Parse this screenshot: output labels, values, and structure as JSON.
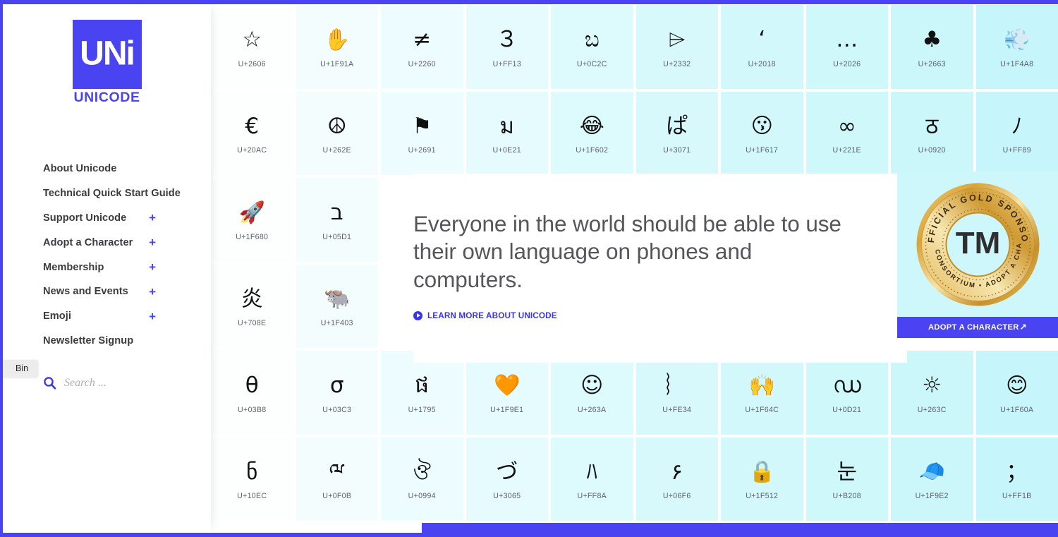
{
  "site": {
    "logo_letters": "UNi",
    "logo_word": "UNICODE"
  },
  "sidebar": {
    "nav": [
      {
        "label": "About Unicode",
        "expandable": false,
        "external": false
      },
      {
        "label": "Technical Quick Start Guide",
        "expandable": false,
        "external": false
      },
      {
        "label": "Support Unicode",
        "expandable": true,
        "plus": "+",
        "external": false
      },
      {
        "label": "Adopt a Character",
        "expandable": true,
        "plus": "+",
        "external": false
      },
      {
        "label": "Membership",
        "expandable": true,
        "plus": "+",
        "external": false
      },
      {
        "label": "News and Events",
        "expandable": true,
        "plus": "+",
        "external": false
      },
      {
        "label": "Emoji",
        "expandable": true,
        "plus": "+",
        "external": false
      },
      {
        "label": "Newsletter Signup",
        "expandable": false,
        "external": true,
        "external_glyph": "↗"
      }
    ],
    "search": {
      "icon": "search-icon",
      "value": "",
      "placeholder": "Search ..."
    }
  },
  "desktop": {
    "tooltip": "Bin"
  },
  "hero": {
    "title": "Everyone in the world should be able to use their own language on phones and computers.",
    "link_label": "LEARN MORE ABOUT UNICODE",
    "link_icon": "play-circle-icon"
  },
  "sponsor": {
    "badge_top_text": "OFFICIAL GOLD SPONSOR",
    "badge_bottom_text": "UNICODE CONSORTIUM • ADOPT A CHARACTER",
    "badge_center": "TM",
    "button_label": "ADOPT A CHARACTER",
    "button_external_glyph": "↗",
    "card_bg": "#cdf7fb",
    "button_bg": "#4a43f2",
    "gold": "#d9a33a"
  },
  "colors": {
    "brand_blue": "#4a43f2",
    "link_blue": "#3a34e8",
    "tile_cyan": "#cdf7fb",
    "text_gray": "#3b3b3f"
  },
  "grid": {
    "columns": 10,
    "tiles": [
      {
        "glyph": "☆",
        "code": "U+2606",
        "shade": 0
      },
      {
        "glyph": "✋",
        "code": "U+1F91A",
        "shade": 1,
        "emoji": true
      },
      {
        "glyph": "≠",
        "code": "U+2260",
        "shade": 2
      },
      {
        "glyph": "３",
        "code": "U+FF13",
        "shade": 3
      },
      {
        "glyph": "ಬ",
        "code": "U+0C2C",
        "shade": 4
      },
      {
        "glyph": "⌲",
        "code": "U+2332",
        "shade": 5
      },
      {
        "glyph": "‘",
        "code": "U+2018",
        "shade": 6
      },
      {
        "glyph": "…",
        "code": "U+2026",
        "shade": 7
      },
      {
        "glyph": "♣",
        "code": "U+2663",
        "shade": 8
      },
      {
        "glyph": "💨",
        "code": "U+1F4A8",
        "shade": 9,
        "emoji": true
      },
      {
        "glyph": "€",
        "code": "U+20AC",
        "shade": 0
      },
      {
        "glyph": "☮",
        "code": "U+262E",
        "shade": 1
      },
      {
        "glyph": "⚑",
        "code": "U+2691",
        "shade": 2
      },
      {
        "glyph": "ม",
        "code": "U+0E21",
        "shade": 3
      },
      {
        "glyph": "😂",
        "code": "U+1F602",
        "shade": 4,
        "emoji": true
      },
      {
        "glyph": "ぱ",
        "code": "U+3071",
        "shade": 5
      },
      {
        "glyph": "😗",
        "code": "U+1F617",
        "shade": 6,
        "emoji": true
      },
      {
        "glyph": "∞",
        "code": "U+221E",
        "shade": 7
      },
      {
        "glyph": "ठ",
        "code": "U+0920",
        "shade": 8
      },
      {
        "glyph": "ﾉ",
        "code": "U+FF89",
        "shade": 9
      },
      {
        "glyph": "🚀",
        "code": "U+1F680",
        "shade": 0,
        "emoji": true
      },
      {
        "glyph": "ב",
        "code": "U+05D1",
        "shade": 1
      },
      {
        "glyph": "炎",
        "code": "U+708E",
        "shade": 0
      },
      {
        "glyph": "🐃",
        "code": "U+1F403",
        "shade": 1,
        "emoji": true
      },
      {
        "glyph": "θ",
        "code": "U+03B8",
        "shade": 0
      },
      {
        "glyph": "σ",
        "code": "U+03C3",
        "shade": 1
      },
      {
        "glyph": "ផ",
        "code": "U+1795",
        "shade": 2
      },
      {
        "glyph": "🧡",
        "code": "U+1F9E1",
        "shade": 3,
        "emoji": true
      },
      {
        "glyph": "☺",
        "code": "U+263A",
        "shade": 4
      },
      {
        "glyph": "︴",
        "code": "U+FE34",
        "shade": 5
      },
      {
        "glyph": "🙌",
        "code": "U+1F64C",
        "shade": 6,
        "emoji": true
      },
      {
        "glyph": "ഡ",
        "code": "U+0D21",
        "shade": 7
      },
      {
        "glyph": "☼",
        "code": "U+263C",
        "shade": 8
      },
      {
        "glyph": "😊",
        "code": "U+1F60A",
        "shade": 9,
        "emoji": true
      },
      {
        "glyph": "ნ",
        "code": "U+10EC",
        "shade": 0
      },
      {
        "glyph": "ྋ",
        "code": "U+0F0B",
        "shade": 1
      },
      {
        "glyph": "ঔ",
        "code": "U+0994",
        "shade": 2
      },
      {
        "glyph": "づ",
        "code": "U+3065",
        "shade": 3
      },
      {
        "glyph": "ﾊ",
        "code": "U+FF8A",
        "shade": 4
      },
      {
        "glyph": "۶",
        "code": "U+06F6",
        "shade": 5
      },
      {
        "glyph": "🔒",
        "code": "U+1F512",
        "shade": 6,
        "emoji": true
      },
      {
        "glyph": "눈",
        "code": "U+B208",
        "shade": 7
      },
      {
        "glyph": "🧢",
        "code": "U+1F9E2",
        "shade": 8,
        "emoji": true
      },
      {
        "glyph": "；",
        "code": "U+FF1B",
        "shade": 9
      }
    ]
  }
}
